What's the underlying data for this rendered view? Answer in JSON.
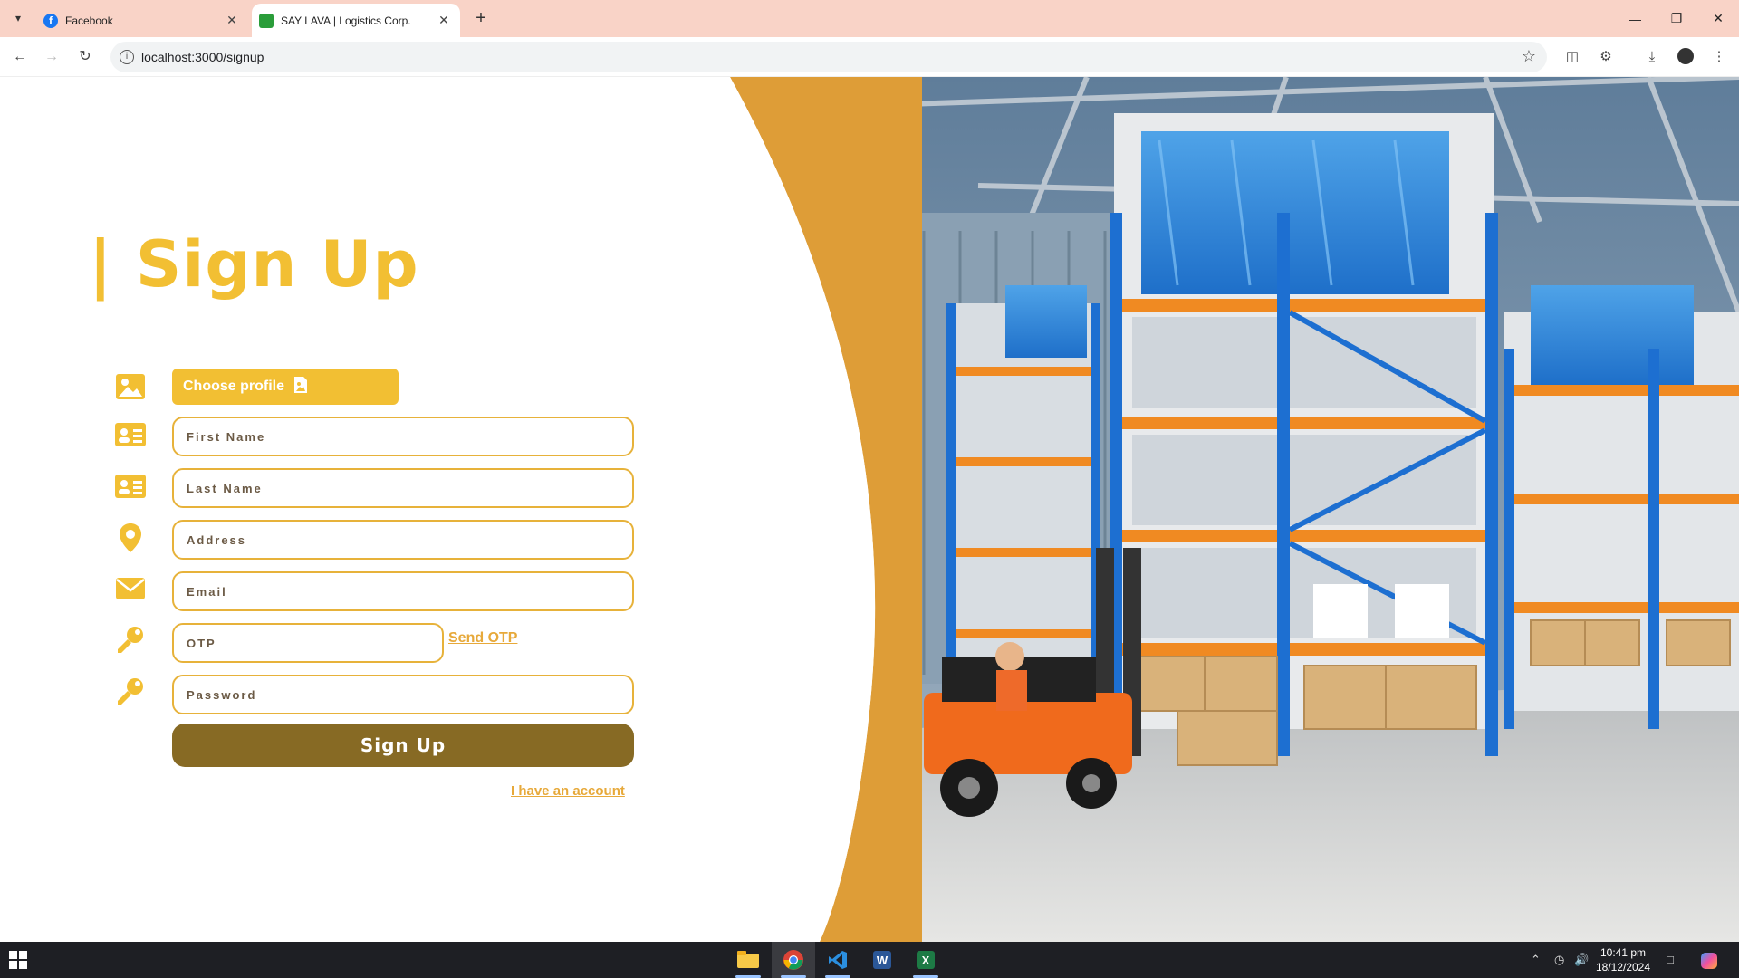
{
  "browser": {
    "tabs": [
      {
        "title": "Facebook",
        "active": false,
        "favicon": "facebook-icon"
      },
      {
        "title": "SAY LAVA | Logistics Corp.",
        "active": true,
        "favicon": "site-icon"
      }
    ],
    "url": "localhost:3000/signup"
  },
  "signup": {
    "heading": "| Sign Up",
    "choose_profile_label": "Choose profile",
    "first_name_placeholder": "First Name",
    "last_name_placeholder": "Last Name",
    "address_placeholder": "Address",
    "email_placeholder": "Email",
    "otp_placeholder": "OTP",
    "send_otp_label": "Send OTP",
    "password_placeholder": "Password",
    "submit_label": "Sign Up",
    "account_link": "I have an account"
  },
  "colors": {
    "accent": "#f2bf33",
    "field_border": "#e7b23a",
    "curve": "#de9d37",
    "submit_bg": "#876a24"
  },
  "taskbar": {
    "apps": [
      "file-explorer-icon",
      "chrome-icon",
      "vscode-icon",
      "word-icon",
      "excel-icon"
    ],
    "time": "10:41 pm",
    "date": "18/12/2024"
  }
}
